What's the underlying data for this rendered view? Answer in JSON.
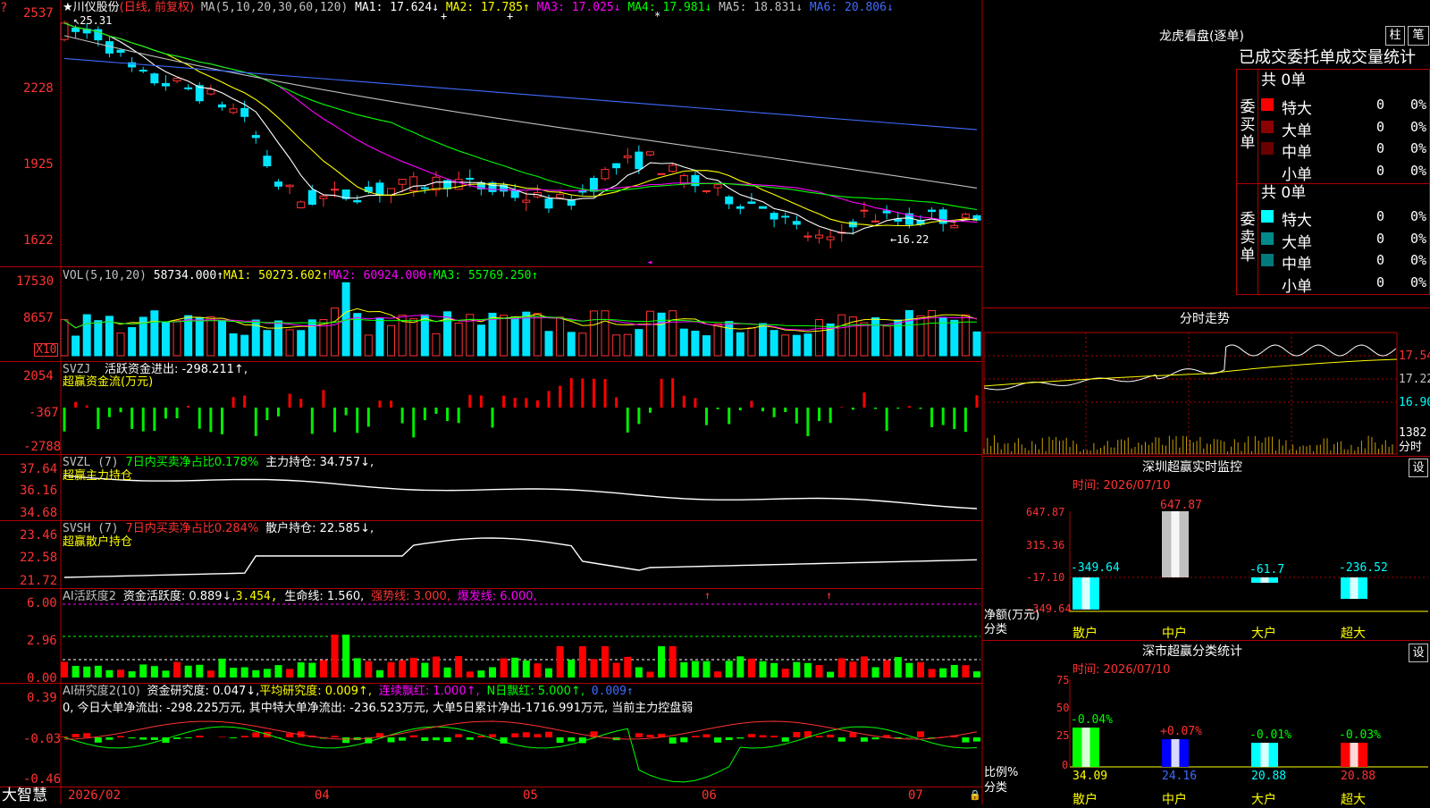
{
  "main_chart": {
    "stock_label": "★川仪股份",
    "mode": "(日线, 前复权)",
    "ma_prefix": "MA(5,10,20,30,60,120)",
    "ma_values": [
      {
        "label": "MA1: 17.624",
        "arrow": "↓",
        "color": "#ffffff"
      },
      {
        "label": "MA2: 17.785",
        "arrow": "↑",
        "color": "#ffff00"
      },
      {
        "label": "MA3: 17.025",
        "arrow": "↓",
        "color": "#ff00ff"
      },
      {
        "label": "MA4: 17.981",
        "arrow": "↓",
        "color": "#00ff00"
      },
      {
        "label": "MA5: 18.831",
        "arrow": "↓",
        "color": "#c0c0c0"
      },
      {
        "label": "MA6: 20.806",
        "arrow": "↓",
        "color": "#3f6bff"
      }
    ],
    "y_ticks": [
      "2537",
      "2228",
      "1925",
      "1622"
    ],
    "high_label": "25.31",
    "low_label": "←16.22"
  },
  "vol_panel": {
    "header": "VOL(5,10,20)",
    "vol_value": "58734.000↑",
    "ma1": "MA1: 50273.602↑",
    "ma2": "MA2: 60924.000↑",
    "ma3": "MA3: 55769.250↑",
    "y_ticks": [
      "17530",
      "8657"
    ],
    "unit_label": "X10"
  },
  "svzj_panel": {
    "header": "SVZJ",
    "line1": "活跃资金进出: -298.211↑,",
    "line2": "超赢资金流(万元)",
    "y_ticks": [
      "2054",
      "-367",
      "-2788"
    ]
  },
  "svzl_panel": {
    "header": "SVZL (7)",
    "ratio": "7日内买卖净占比0.178%",
    "hold": "主力持仓: 34.757↓,",
    "line2": "超赢主力持仓",
    "y_ticks": [
      "37.64",
      "36.16",
      "34.68"
    ]
  },
  "svsh_panel": {
    "header": "SVSH (7)",
    "ratio": "7日内买卖净占比0.284%",
    "hold": "散户持仓: 22.585↓,",
    "line2": "超赢散户持仓",
    "y_ticks": [
      "23.46",
      "22.58",
      "21.72"
    ]
  },
  "ai_active_panel": {
    "header": "AI活跃度2",
    "active": "资金活跃度: 0.889↓,",
    "v2": "3.454,",
    "life": "生命线: 1.560,",
    "strong": "强势线: 3.000,",
    "burst": "爆发线: 6.000,",
    "y_ticks": [
      "6.00",
      "2.96",
      "0.00"
    ]
  },
  "ai_research_panel": {
    "header": "AI研究度2(10)",
    "research": "资金研究度: 0.047↓,",
    "avg": "平均研究度: 0.009↑,",
    "cont": "连续飘红: 1.000↑,",
    "nday": "N日飘红: 5.000↑,",
    "val": "0.009↑",
    "summary": "0, 今日大单净流出: -298.225万元, 其中特大单净流出: -236.523万元, 大单5日累计净出-1716.991万元, 当前主力控盘弱",
    "y_ticks": [
      "0.39",
      "-0.03",
      "-0.46"
    ]
  },
  "x_axis": {
    "labels": [
      "2026/02",
      "04",
      "05",
      "06",
      "07"
    ]
  },
  "brand": "大智慧",
  "right_panel": {
    "title": "龙虎看盘(逐单)",
    "btn_bar": "柱",
    "btn_pen": "笔",
    "stats_title": "已成交委托单成交量统计",
    "buy_side": {
      "label": "委买单",
      "total": "共 0单",
      "rows": [
        {
          "name": "特大",
          "val": "0",
          "pct": "0%",
          "color": "#ff0000"
        },
        {
          "name": "大单",
          "val": "0",
          "pct": "0%",
          "color": "#8b0000"
        },
        {
          "name": "中单",
          "val": "0",
          "pct": "0%",
          "color": "#6a0000"
        },
        {
          "name": "小单",
          "val": "0",
          "pct": "0%",
          "color": "#000000"
        }
      ]
    },
    "sell_side": {
      "label": "委卖单",
      "total": "共 0单",
      "rows": [
        {
          "name": "特大",
          "val": "0",
          "pct": "0%",
          "color": "#00ffff"
        },
        {
          "name": "大单",
          "val": "0",
          "pct": "0%",
          "color": "#008b8b"
        },
        {
          "name": "中单",
          "val": "0",
          "pct": "0%",
          "color": "#007a7a"
        },
        {
          "name": "小单",
          "val": "0",
          "pct": "0%",
          "color": "#000000"
        }
      ]
    },
    "intraday": {
      "title": "分时走势",
      "prices": [
        "17.54",
        "17.22",
        "16.90"
      ],
      "vol": "1382",
      "vol_unit": "分时"
    },
    "sz_monitor": {
      "title": "深圳超赢实时监控",
      "btn": "设",
      "time": "时间: 2026/07/10",
      "y_ticks": [
        "647.87",
        "315.36",
        "-17.10",
        "-349.64"
      ],
      "left_label1": "净额(万元)",
      "left_label2": "分类",
      "bars": [
        {
          "cat": "散户",
          "value": "-349.64"
        },
        {
          "cat": "中户",
          "value": "647.87"
        },
        {
          "cat": "大户",
          "value": "-61.7"
        },
        {
          "cat": "超大",
          "value": "-236.52"
        }
      ]
    },
    "sz_class": {
      "title": "深市超赢分类统计",
      "btn": "设",
      "time": "时间: 2026/07/10",
      "y_ticks": [
        "75",
        "50",
        "25",
        "0"
      ],
      "left_label1": "比例%",
      "left_label2": "分类",
      "bars": [
        {
          "cat": "散户",
          "value": "34.09",
          "delta": "-0.04%"
        },
        {
          "cat": "中户",
          "value": "24.16",
          "delta": "+0.07%"
        },
        {
          "cat": "大户",
          "value": "20.88",
          "delta": "-0.01%"
        },
        {
          "cat": "超大",
          "value": "20.88",
          "delta": "-0.03%"
        }
      ]
    }
  },
  "colors": {
    "up": "#ff3232",
    "down": "#00e5ff",
    "frame": "#b00000",
    "bg": "#000000"
  }
}
